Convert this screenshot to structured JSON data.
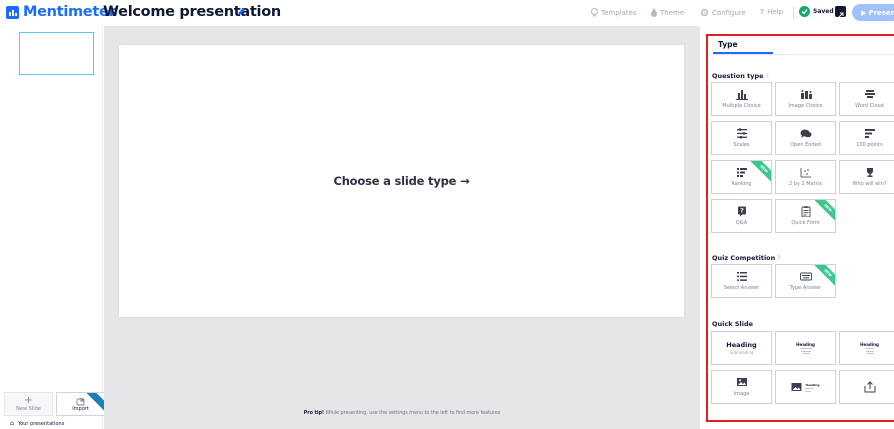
{
  "header": {
    "brand": "Mentimeter",
    "title": "Welcome presentation",
    "nav": {
      "templates": "Templates",
      "theme": "Theme",
      "configure": "Configure",
      "help": "Help"
    },
    "saved_label": "Saved",
    "present_label": "Present"
  },
  "left": {
    "new_slide": "New Slide",
    "import": "Import",
    "your_presentations": "Your presentations"
  },
  "canvas": {
    "prompt": "Choose a slide type →",
    "protip_bold": "Pro tip!",
    "protip_text": " While presenting, use the settings menu to the left to find more features"
  },
  "panel": {
    "tab": "Type",
    "question_type": {
      "title": "Question type",
      "help": "?",
      "items": [
        {
          "label": "Multiple Choice",
          "icon": "bar-chart-icon"
        },
        {
          "label": "Image Choice",
          "icon": "image-choice-icon"
        },
        {
          "label": "Word Cloud",
          "icon": "word-cloud-icon"
        },
        {
          "label": "Scales",
          "icon": "scales-icon"
        },
        {
          "label": "Open Ended",
          "icon": "speech-bubbles-icon"
        },
        {
          "label": "100 points",
          "icon": "points-icon"
        },
        {
          "label": "Ranking",
          "icon": "ranking-icon",
          "badge": "NEW"
        },
        {
          "label": "2 by 2 Matrix",
          "icon": "matrix-icon"
        },
        {
          "label": "Who will win?",
          "icon": "trophy-icon"
        },
        {
          "label": "Q&A",
          "icon": "qa-icon"
        },
        {
          "label": "Quick Form",
          "icon": "clipboard-icon",
          "badge": "NEW"
        }
      ]
    },
    "quiz": {
      "title": "Quiz Competition",
      "help": "?",
      "items": [
        {
          "label": "Select Answer",
          "icon": "list-icon"
        },
        {
          "label": "Type Answer",
          "icon": "keyboard-icon",
          "badge": "NEW"
        }
      ]
    },
    "quick_slide": {
      "title": "Quick Slide",
      "heading_title": "Heading",
      "heading_sub": "Subheading",
      "mini_heading": "Heading",
      "image_label": "Image"
    }
  },
  "colors": {
    "brand": "#196cff",
    "highlight_border": "#e0201f",
    "new_badge": "#3bc88d",
    "saved": "#14a86e"
  }
}
